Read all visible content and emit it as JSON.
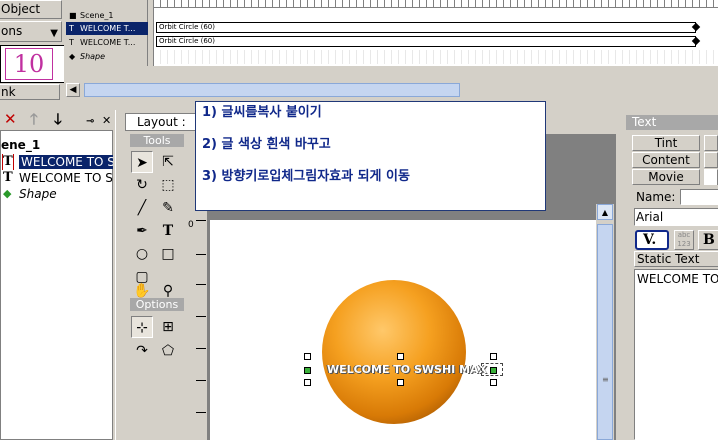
{
  "top_left": {
    "object_label": "Object",
    "options_label": "ons",
    "frame_number": "10",
    "link_label": "nk"
  },
  "timeline": {
    "layers": [
      {
        "name": "Scene_1"
      },
      {
        "name": "WELCOME T..."
      },
      {
        "name": "WELCOME T..."
      },
      {
        "name": "Shape"
      }
    ],
    "tweens": [
      "Orbit Circle (60)",
      "Orbit Circle (60)"
    ]
  },
  "object_tree": {
    "scene": "ene_1",
    "items": [
      "WELCOME TO S",
      "WELCOME TO S",
      "Shape"
    ]
  },
  "layout": {
    "tab_label": "Layout : S",
    "tools_header": "Tools",
    "options_header": "Options",
    "ruler_zero": "0"
  },
  "stage": {
    "text": "WELCOME TO SWSHI MAX",
    "sphere_color": "#f5a020"
  },
  "instructions": [
    "1) 글씨를복사 붙이기",
    "2) 글 색상 흰색 바꾸고",
    "3) 방향키로입체그림자효과 되게 이동"
  ],
  "text_panel": {
    "header": "Text",
    "tabs": [
      "Tint",
      "Content",
      "Movie"
    ],
    "name_label": "Name:",
    "font": "Arial",
    "v_label": "V.",
    "abc_label": "abc 123",
    "bold_label": "B",
    "static_label": "Static Text",
    "content": "WELCOME TO"
  },
  "colors": {
    "selection": "#0a246a",
    "instruction_text": "#10288a",
    "frame_number": "#c030a0"
  }
}
